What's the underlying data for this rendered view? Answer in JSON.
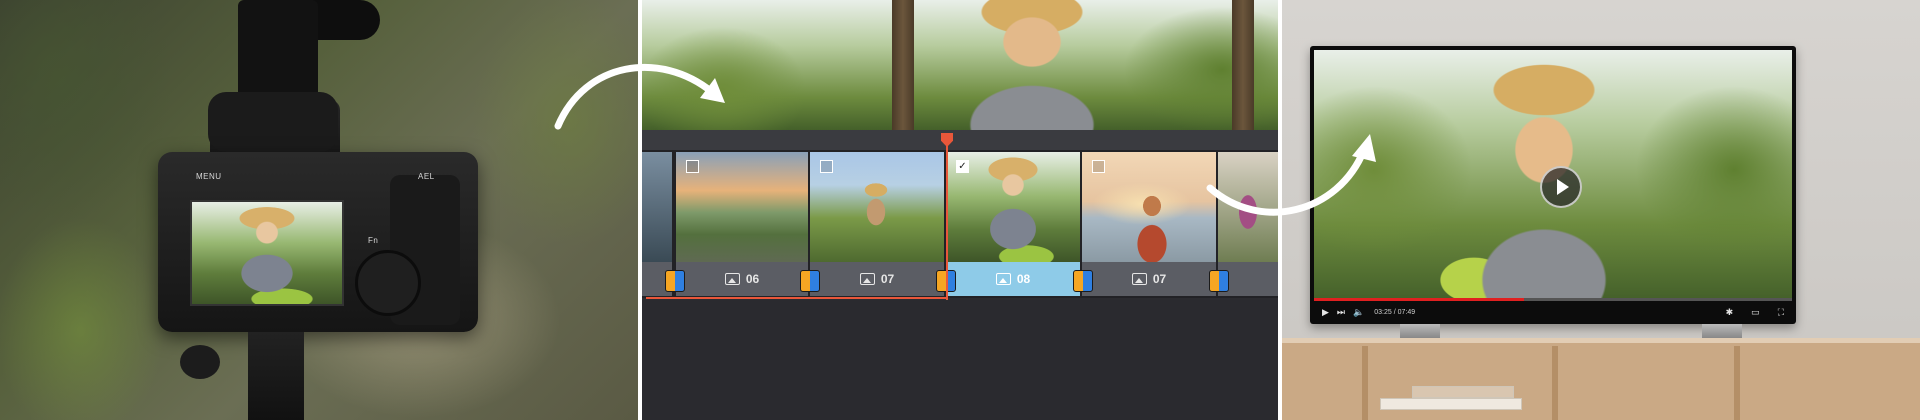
{
  "camera": {
    "labels": {
      "menu": "MENU",
      "ael": "AEL",
      "fn": "Fn"
    }
  },
  "editor": {
    "clips": [
      {
        "label": "",
        "checked": false,
        "kind": "edge"
      },
      {
        "label": "06",
        "checked": false,
        "kind": "landscape"
      },
      {
        "label": "07",
        "checked": false,
        "kind": "garden"
      },
      {
        "label": "08",
        "checked": true,
        "kind": "laughing"
      },
      {
        "label": "07",
        "checked": false,
        "kind": "beach"
      },
      {
        "label": "",
        "checked": false,
        "kind": "edge"
      }
    ],
    "accent_color": "#e9573a",
    "selected_color": "#8ecbe8"
  },
  "tv": {
    "time": "03:25 / 07:49",
    "progress": 0.44,
    "progress_color": "#e02020"
  },
  "icons": [
    "camera-icon",
    "play-icon",
    "next-icon",
    "volume-icon",
    "settings-icon",
    "theater-icon",
    "fullscreen-icon",
    "image-icon",
    "checkbox-icon"
  ]
}
